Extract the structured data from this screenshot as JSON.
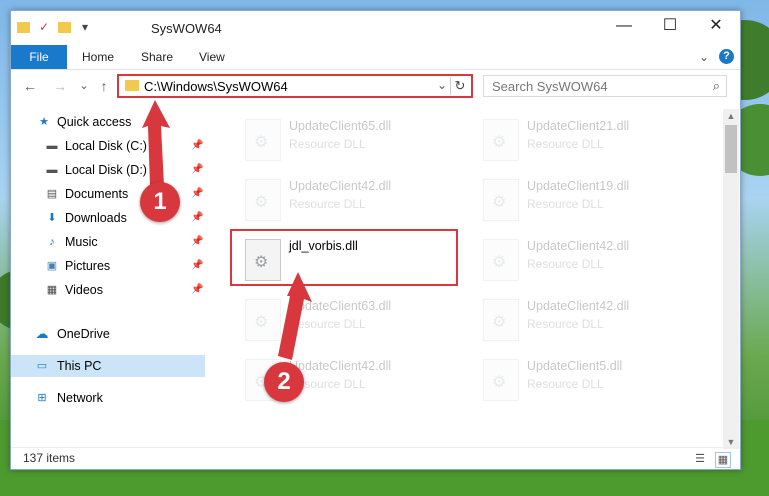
{
  "window": {
    "title": "SysWOW64",
    "minimize_glyph": "—",
    "maximize_glyph": "☐",
    "close_glyph": "✕"
  },
  "ribbon": {
    "tabs": [
      "File",
      "Home",
      "Share",
      "View"
    ],
    "expand_glyph": "⌄",
    "help_glyph": "?"
  },
  "address": {
    "path": "C:\\Windows\\SysWOW64",
    "dropdown_glyph": "⌄",
    "refresh_glyph": "↻"
  },
  "search": {
    "placeholder": "Search SysWOW64",
    "icon_glyph": "⌕"
  },
  "nav_buttons": {
    "back": "←",
    "forward": "→",
    "recent": "⌄",
    "up": "↑"
  },
  "sidebar": {
    "quick_access": "Quick access",
    "pinned": [
      {
        "label": "Local Disk (C:)",
        "icon": "drive-icon",
        "glyph": "▬"
      },
      {
        "label": "Local Disk (D:)",
        "icon": "drive-icon",
        "glyph": "▬"
      },
      {
        "label": "Documents",
        "icon": "documents-icon",
        "glyph": "▤"
      },
      {
        "label": "Downloads",
        "icon": "downloads-icon",
        "glyph": "⬇"
      },
      {
        "label": "Music",
        "icon": "music-icon",
        "glyph": "♪"
      },
      {
        "label": "Pictures",
        "icon": "pictures-icon",
        "glyph": "▣"
      },
      {
        "label": "Videos",
        "icon": "videos-icon",
        "glyph": "▦"
      }
    ],
    "onedrive": "OneDrive",
    "this_pc": "This PC",
    "network": "Network",
    "pin_glyph": "📌"
  },
  "files": {
    "left": [
      {
        "name": "UpdateClient65.dll",
        "type": "Resource DLL"
      },
      {
        "name": "UpdateClient42.dll",
        "type": "Resource DLL"
      },
      {
        "name": "jdl_vorbis.dll",
        "type": ""
      },
      {
        "name": "UpdateClient63.dll",
        "type": "Resource DLL"
      },
      {
        "name": "UpdateClient42.dll",
        "type": "Resource DLL"
      }
    ],
    "right": [
      {
        "name": "UpdateClient21.dll",
        "type": "Resource DLL"
      },
      {
        "name": "UpdateClient19.dll",
        "type": "Resource DLL"
      },
      {
        "name": "UpdateClient42.dll",
        "type": "Resource DLL"
      },
      {
        "name": "UpdateClient42.dll",
        "type": "Resource DLL"
      },
      {
        "name": "UpdateClient5.dll",
        "type": "Resource DLL"
      }
    ]
  },
  "status": {
    "item_count": "137 items"
  },
  "markers": {
    "one": "1",
    "two": "2",
    "color": "#d9373e"
  }
}
